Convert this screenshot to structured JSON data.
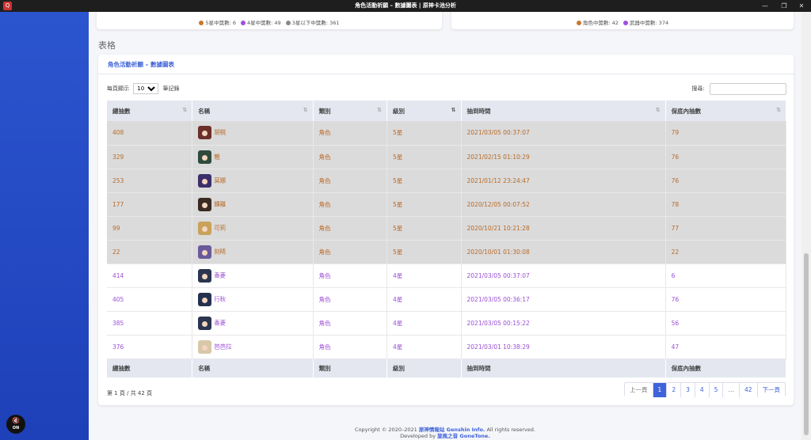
{
  "window": {
    "title": "角色活動祈願 – 數據圖表 | 原神卡池分析",
    "app_icon": "Q",
    "minimize": "—",
    "maximize": "❐",
    "close": "✕"
  },
  "sidebar": {
    "sound_label": "ON",
    "sound_icon": "speaker-muted-icon"
  },
  "top_cards": {
    "left_legend": [
      {
        "label": "5星中獎數: 6",
        "color": "#c9772c"
      },
      {
        "label": "4星中獎數: 49",
        "color": "#a04fe0"
      },
      {
        "label": "3星以下中獎數: 361",
        "color": "#8a8a8a"
      }
    ],
    "right_legend": [
      {
        "label": "角色中獎數: 42",
        "color": "#c9772c"
      },
      {
        "label": "武器中獎數: 374",
        "color": "#a04fe0"
      }
    ]
  },
  "section_title": "表格",
  "table_card": {
    "title": "角色活動祈願 – 數據圖表",
    "show_prefix": "每頁顯示",
    "show_value": "10",
    "show_suffix": "筆記錄",
    "search_label": "搜尋:",
    "search_value": "",
    "columns": [
      "總抽數",
      "名稱",
      "類別",
      "級別",
      "抽到時間",
      "保底內抽數"
    ],
    "rows": [
      {
        "total": "408",
        "name": "胡桃",
        "type": "角色",
        "rarity": "5星",
        "time": "2021/03/05 00:37:07",
        "pity": "79",
        "star": 5,
        "avatar_color": "#6b2f2a"
      },
      {
        "total": "329",
        "name": "魈",
        "type": "角色",
        "rarity": "5星",
        "time": "2021/02/15 01:10:29",
        "pity": "76",
        "star": 5,
        "avatar_color": "#2f4a3c"
      },
      {
        "total": "253",
        "name": "莫娜",
        "type": "角色",
        "rarity": "5星",
        "time": "2021/01/12 23:24:47",
        "pity": "76",
        "star": 5,
        "avatar_color": "#3c2f6b"
      },
      {
        "total": "177",
        "name": "鍾離",
        "type": "角色",
        "rarity": "5星",
        "time": "2020/12/05 00:07:52",
        "pity": "78",
        "star": 5,
        "avatar_color": "#3a2a22"
      },
      {
        "total": "99",
        "name": "可莉",
        "type": "角色",
        "rarity": "5星",
        "time": "2020/10/21 10:21:28",
        "pity": "77",
        "star": 5,
        "avatar_color": "#c9a15b"
      },
      {
        "total": "22",
        "name": "刻晴",
        "type": "角色",
        "rarity": "5星",
        "time": "2020/10/01 01:30:08",
        "pity": "22",
        "star": 5,
        "avatar_color": "#6a5a9a"
      },
      {
        "total": "414",
        "name": "香菱",
        "type": "角色",
        "rarity": "4星",
        "time": "2021/03/05 00:37:07",
        "pity": "6",
        "star": 4,
        "avatar_color": "#2c3550"
      },
      {
        "total": "405",
        "name": "行秋",
        "type": "角色",
        "rarity": "4星",
        "time": "2021/03/05 00:36:17",
        "pity": "76",
        "star": 4,
        "avatar_color": "#24324f"
      },
      {
        "total": "385",
        "name": "香菱",
        "type": "角色",
        "rarity": "4星",
        "time": "2021/03/05 00:15:22",
        "pity": "56",
        "star": 4,
        "avatar_color": "#2c3550"
      },
      {
        "total": "376",
        "name": "芭芭拉",
        "type": "角色",
        "rarity": "4星",
        "time": "2021/03/01 10:38:29",
        "pity": "47",
        "star": 4,
        "avatar_color": "#d8c7a8"
      }
    ],
    "page_info": "第 1 頁 / 共 42 頁",
    "pager": [
      "上一頁",
      "1",
      "2",
      "3",
      "4",
      "5",
      "…",
      "42",
      "下一頁"
    ],
    "active_page": "1"
  },
  "footer": {
    "line1_prefix": "Copyright © 2020–2021",
    "line1_link": "原神情報站 Genshin Info.",
    "line1_suffix": "All rights reserved.",
    "line2_prefix": "Developed by",
    "line2_link": "旋風之音 GoneTone."
  }
}
